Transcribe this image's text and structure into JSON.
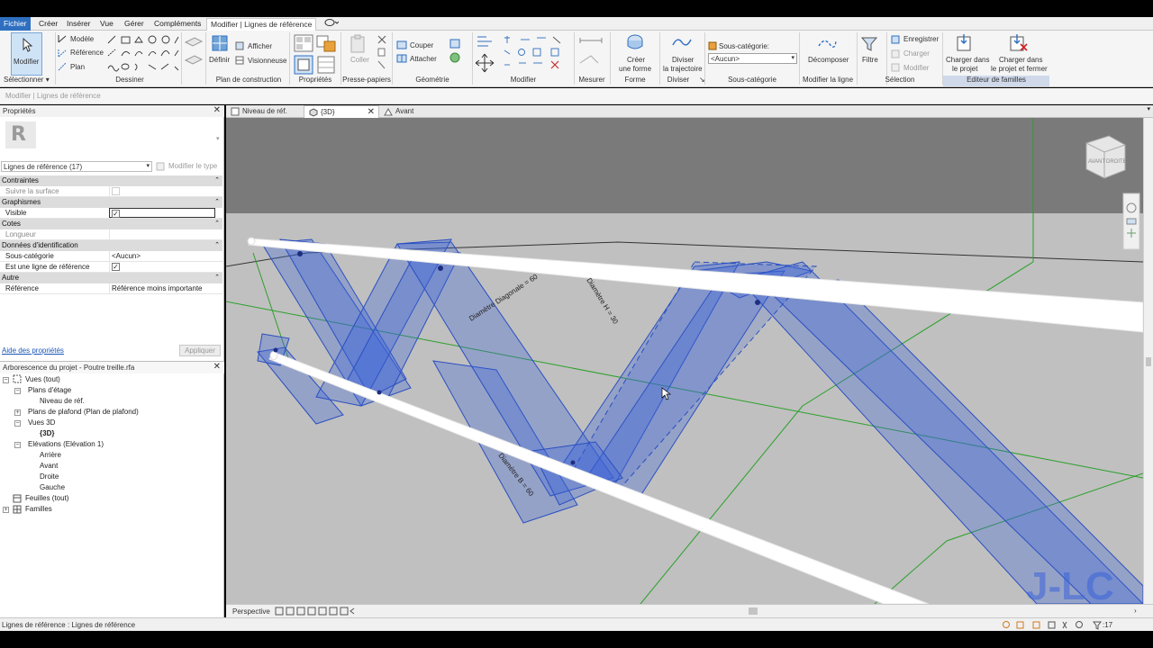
{
  "ribbon_tabs": [
    "Fichier",
    "Créer",
    "Insérer",
    "Vue",
    "Gérer",
    "Compléments",
    "Modifier | Lignes de référence"
  ],
  "ribbon": {
    "modifier_label": "Modifier",
    "selectionner_label": "Sélectionner ▾",
    "draw_buttons": [
      "Modèle",
      "Référence",
      "Plan"
    ],
    "definir_label": "Définir",
    "afficher_label": "Afficher",
    "visionneuse_label": "Visionneuse",
    "coller_label": "Coller",
    "couper_label": "Couper",
    "attacher_label": "Attacher",
    "creer_forme_label": [
      "Créer",
      "une forme"
    ],
    "diviser_label": [
      "Diviser",
      "la trajectoire"
    ],
    "sous_categorie_label": "Sous-catégorie:",
    "sous_categorie_value": "<Aucun>",
    "decomposer_label": "Décomposer",
    "filtre_label": "Filtre",
    "enregistrer_label": "Enregistrer",
    "charger_label": "Charger",
    "modifier_dim_label": "Modifier",
    "charger_projet_label": [
      "Charger dans",
      "le projet"
    ],
    "charger_fermer_label": [
      "Charger dans",
      "le projet et fermer"
    ],
    "panels": [
      "Dessiner",
      "Plan de construction",
      "Propriétés",
      "Presse-papiers",
      "Géométrie",
      "Modifier",
      "Mesurer",
      "Forme",
      "Diviser",
      "Sous-catégorie",
      "Modifier la ligne",
      "Sélection",
      "Editeur de familles"
    ]
  },
  "context_bar": "Modifier | Lignes de référence",
  "properties": {
    "title": "Propriétés",
    "type_selector": "Lignes de référence (17)",
    "edit_type": "Modifier le type",
    "sections": [
      {
        "name": "Contraintes",
        "rows": [
          {
            "key": "Suivre la surface",
            "value": "",
            "checkbox": true,
            "checked": false,
            "disabled": true
          }
        ]
      },
      {
        "name": "Graphismes",
        "rows": [
          {
            "key": "Visible",
            "value": "",
            "checkbox": true,
            "checked": true,
            "disabled": false
          }
        ]
      },
      {
        "name": "Cotes",
        "rows": [
          {
            "key": "Longueur",
            "value": "",
            "checkbox": false,
            "disabled": true
          }
        ]
      },
      {
        "name": "Données d'identification",
        "rows": [
          {
            "key": "Sous-catégorie",
            "value": "<Aucun>",
            "checkbox": false
          },
          {
            "key": "Est une ligne de référence",
            "value": "",
            "checkbox": true,
            "checked": true
          }
        ]
      },
      {
        "name": "Autre",
        "rows": [
          {
            "key": "Référence",
            "value": "Référence moins importante",
            "checkbox": false
          }
        ]
      }
    ],
    "help_link": "Aide des propriétés",
    "apply_button": "Appliquer"
  },
  "browser": {
    "title": "Arborescence du projet - Poutre treille.rfa",
    "items": [
      {
        "label": "Vues (tout)",
        "level": 0,
        "expander": "−"
      },
      {
        "label": "Plans d'étage",
        "level": 1,
        "expander": "−"
      },
      {
        "label": "Niveau de réf.",
        "level": 2,
        "expander": ""
      },
      {
        "label": "Plans de plafond (Plan de plafond)",
        "level": 1,
        "expander": "+"
      },
      {
        "label": "Vues 3D",
        "level": 1,
        "expander": "−"
      },
      {
        "label": "{3D}",
        "level": 2,
        "expander": "",
        "bold": true
      },
      {
        "label": "Elévations (Elévation 1)",
        "level": 1,
        "expander": "−"
      },
      {
        "label": "Arrière",
        "level": 2,
        "expander": ""
      },
      {
        "label": "Avant",
        "level": 2,
        "expander": ""
      },
      {
        "label": "Droite",
        "level": 2,
        "expander": ""
      },
      {
        "label": "Gauche",
        "level": 2,
        "expander": ""
      },
      {
        "label": "Feuilles (tout)",
        "level": 0,
        "expander": ""
      },
      {
        "label": "Familles",
        "level": 0,
        "expander": "+"
      }
    ]
  },
  "view_tabs": [
    {
      "label": "Niveau de réf.",
      "active": false,
      "closable": false
    },
    {
      "label": "{3D}",
      "active": true,
      "closable": true
    },
    {
      "label": "Avant",
      "active": false,
      "closable": false
    }
  ],
  "viewport": {
    "viewcube_faces": [
      "AVANT",
      "DROITE"
    ],
    "dimension_labels": [
      "Diamètre Diagonale = 60",
      "Diamètre H = 30",
      "Diamètre B = 60"
    ],
    "watermark": "J-LC"
  },
  "view_control": {
    "mode": "Perspective"
  },
  "status_bar": {
    "text": "Lignes de référence : Lignes de référence",
    "selection_count": ":17"
  },
  "colors": {
    "accent": "#2f6fc0",
    "selection_blue": "#3b63d9",
    "viewport_bg": "#c0c0c0"
  }
}
